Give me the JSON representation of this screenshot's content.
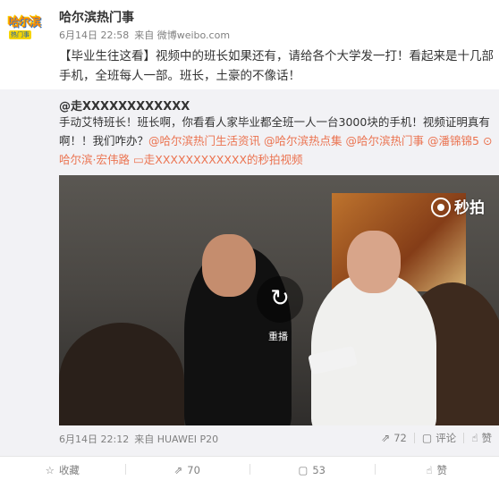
{
  "post": {
    "avatar_text": "哈尔滨",
    "avatar_sub": "热门事",
    "user_name": "哈尔滨热门事",
    "time": "6月14日 22:58",
    "source": "来自 微博weibo.com",
    "text": "【毕业生往这看】视频中的班长如果还有，请给各个大学发一打！看起来是十几部手机，全班每人一部。班长，土豪的不像话！"
  },
  "repost": {
    "author": "@走XXXXXXXXXXXX",
    "text_plain": "手动艾特班长！班长啊，你看看人家毕业都全班一人一台3000块的手机！视频证明真有啊！！我们咋办？",
    "links": {
      "tag1": "@哈尔滨热门生活资讯",
      "tag2": "@哈尔滨热点集",
      "tag3": "@哈尔滨热门事",
      "tag4": "@潘锦锦5",
      "location": "哈尔滨·宏伟路",
      "video_link": "走XXXXXXXXXXXX的秒拍视频"
    },
    "video": {
      "watermark": "秒拍",
      "replay_label": "重播"
    },
    "time": "6月14日 22:12",
    "source": "来自 HUAWEI P20",
    "actions": {
      "repost_count": "72",
      "comment_label": "评论",
      "like_label": "赞"
    }
  },
  "bottom_bar": {
    "favorite": "收藏",
    "repost": "70",
    "comment": "53",
    "like": "赞"
  },
  "colors": {
    "link": "#eb7350",
    "meta": "#808080",
    "repost_bg": "#f2f2f5"
  },
  "icons": {
    "location": "location-pin-icon",
    "video": "video-icon",
    "repost": "repost-icon",
    "comment": "comment-icon",
    "like": "thumbs-up-icon",
    "favorite": "star-icon",
    "replay": "replay-icon"
  }
}
